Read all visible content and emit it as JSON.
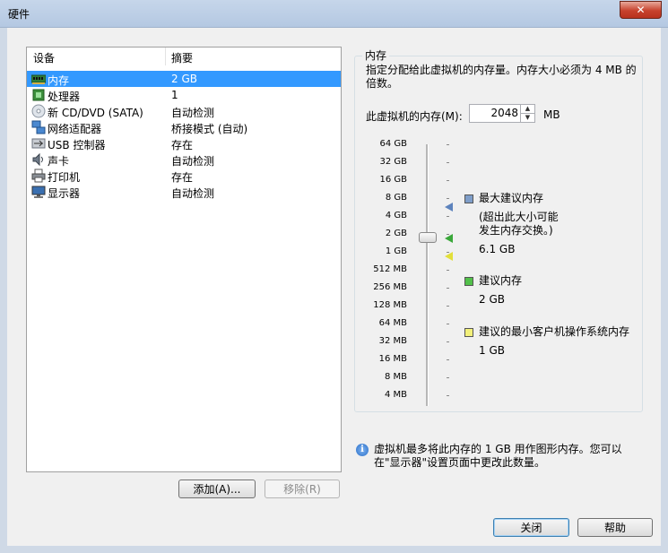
{
  "window": {
    "title": "硬件",
    "close_glyph": "✕"
  },
  "device_list": {
    "headers": [
      "设备",
      "摘要"
    ],
    "rows": [
      {
        "name": "内存",
        "summary": "2 GB",
        "icon": "memory-icon",
        "selected": true
      },
      {
        "name": "处理器",
        "summary": "1",
        "icon": "processor-icon",
        "selected": false
      },
      {
        "name": "新 CD/DVD (SATA)",
        "summary": "自动检测",
        "icon": "cd-dvd-icon",
        "selected": false
      },
      {
        "name": "网络适配器",
        "summary": "桥接模式 (自动)",
        "icon": "network-adapter-icon",
        "selected": false
      },
      {
        "name": "USB 控制器",
        "summary": "存在",
        "icon": "usb-icon",
        "selected": false
      },
      {
        "name": "声卡",
        "summary": "自动检测",
        "icon": "sound-card-icon",
        "selected": false
      },
      {
        "name": "打印机",
        "summary": "存在",
        "icon": "printer-icon",
        "selected": false
      },
      {
        "name": "显示器",
        "summary": "自动检测",
        "icon": "display-icon",
        "selected": false
      }
    ],
    "add_button": "添加(A)...",
    "remove_button": "移除(R)"
  },
  "memory": {
    "group_title": "内存",
    "description": "指定分配给此虚拟机的内存量。内存大小必须为 4 MB 的倍数。",
    "field_label": "此虚拟机的内存(M):",
    "value": "2048",
    "unit": "MB",
    "scale_labels": [
      "64 GB",
      "32 GB",
      "16 GB",
      "8 GB",
      "4 GB",
      "2 GB",
      "1 GB",
      "512 MB",
      "256 MB",
      "128 MB",
      "64 MB",
      "32 MB",
      "16 MB",
      "8 MB",
      "4 MB"
    ],
    "slider_value": "2 GB",
    "legend": {
      "max": {
        "title": "最大建议内存",
        "note_line1": "(超出此大小可能",
        "note_line2": "发生内存交换。)",
        "value": "6.1 GB",
        "color": "#7f9ec9"
      },
      "recommended": {
        "title": "建议内存",
        "value": "2 GB",
        "color": "#52c04a"
      },
      "minimum": {
        "title": "建议的最小客户机操作系统内存",
        "value": "1 GB",
        "color": "#f2f07a"
      }
    }
  },
  "info": {
    "text": "虚拟机最多将此内存的 1 GB 用作图形内存。您可以在\"显示器\"设置页面中更改此数量。"
  },
  "footer": {
    "close_button": "关闭",
    "help_button": "帮助"
  }
}
